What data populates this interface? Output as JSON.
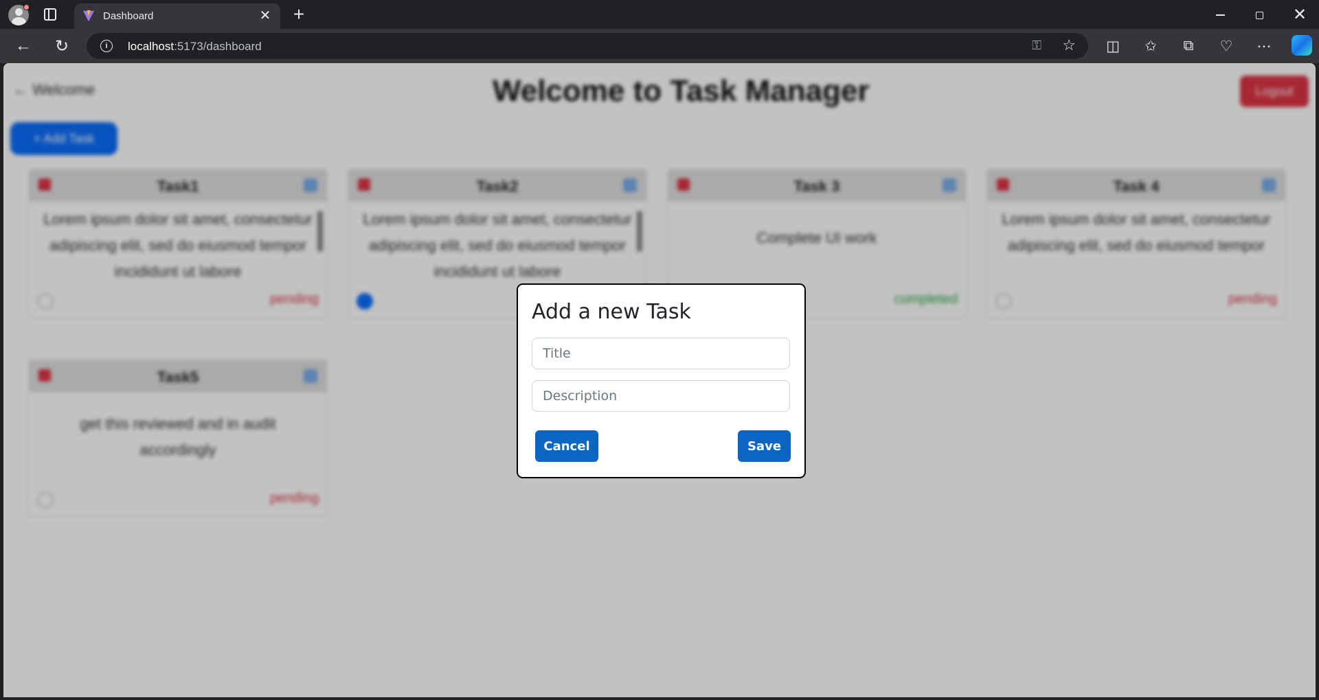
{
  "browser": {
    "tab_title": "Dashboard",
    "url_host": "localhost",
    "url_path": ":5173/dashboard"
  },
  "page": {
    "back_label": "← Welcome",
    "title": "Welcome to Task Manager",
    "logout_label": "Logout",
    "add_task_label": "+ Add Task"
  },
  "tasks": [
    {
      "title": "Task1",
      "description": "Lorem ipsum dolor sit amet, consectetur adipiscing elit, sed do eiusmod tempor incididunt ut labore",
      "status": "pending",
      "status_color": "#dc3545",
      "done": false
    },
    {
      "title": "Task2",
      "description": "Lorem ipsum dolor sit amet, consectetur adipiscing elit, sed do eiusmod tempor incididunt ut labore",
      "status": "",
      "status_color": "#dc3545",
      "done": true
    },
    {
      "title": "Task 3",
      "description": "Complete UI work",
      "status": "completed",
      "status_color": "#28a745",
      "done": false
    },
    {
      "title": "Task 4",
      "description": "Lorem ipsum dolor sit amet, consectetur adipiscing elit, sed do eiusmod tempor",
      "status": "pending",
      "status_color": "#dc3545",
      "done": false
    },
    {
      "title": "Task5",
      "description": "get this reviewed and in audit accordingly",
      "status": "pending",
      "status_color": "#dc3545",
      "done": false
    }
  ],
  "modal": {
    "title": "Add a new Task",
    "title_placeholder": "Title",
    "title_value": "",
    "description_placeholder": "Description",
    "description_value": "",
    "cancel_label": "Cancel",
    "save_label": "Save"
  },
  "colors": {
    "primary_button": "#0a66c2",
    "danger": "#dc3545",
    "overlay": "rgba(0,0,0,0.24)"
  }
}
